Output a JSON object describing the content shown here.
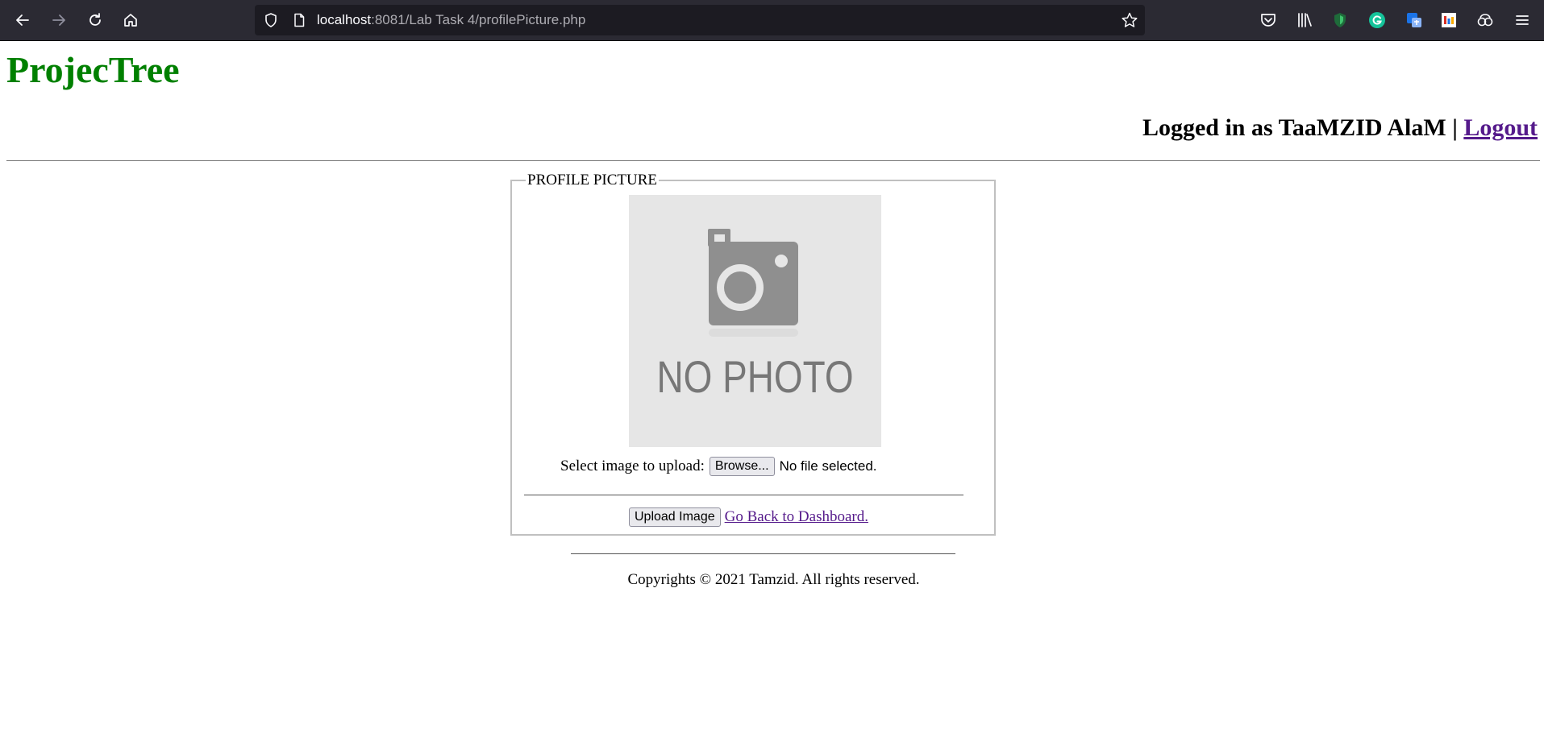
{
  "browser": {
    "url_host": "localhost",
    "url_rest": ":8081/Lab Task 4/profilePicture.php",
    "icons": [
      "back-icon",
      "forward-icon",
      "reload-icon",
      "home-icon",
      "shield-icon",
      "page-icon",
      "bookmark-star-icon",
      "pocket-icon",
      "library-icon",
      "shield-extension-icon",
      "grammarly-icon",
      "translate-icon",
      "color-extension-icon",
      "extension-puzzle-icon",
      "menu-icon"
    ]
  },
  "header": {
    "brand": "ProjecTree",
    "login_prefix": "Logged in as TaaMZID AlaM | ",
    "logout_label": "Logout"
  },
  "form": {
    "legend": "PROFILE PICTURE",
    "photo_placeholder_text": "NO PHOTO",
    "select_label": "Select image to upload:",
    "browse_label": "Browse...",
    "file_status": "No file selected.",
    "upload_button": "Upload Image",
    "back_link": "Go Back to Dashboard."
  },
  "footer": {
    "text": "Copyrights © 2021 Tamzid. All rights reserved."
  },
  "colors": {
    "brand": "#008000",
    "link_visited": "#551a8b",
    "chrome_bg": "#2b2a33",
    "urlbar_bg": "#1c1b22"
  }
}
